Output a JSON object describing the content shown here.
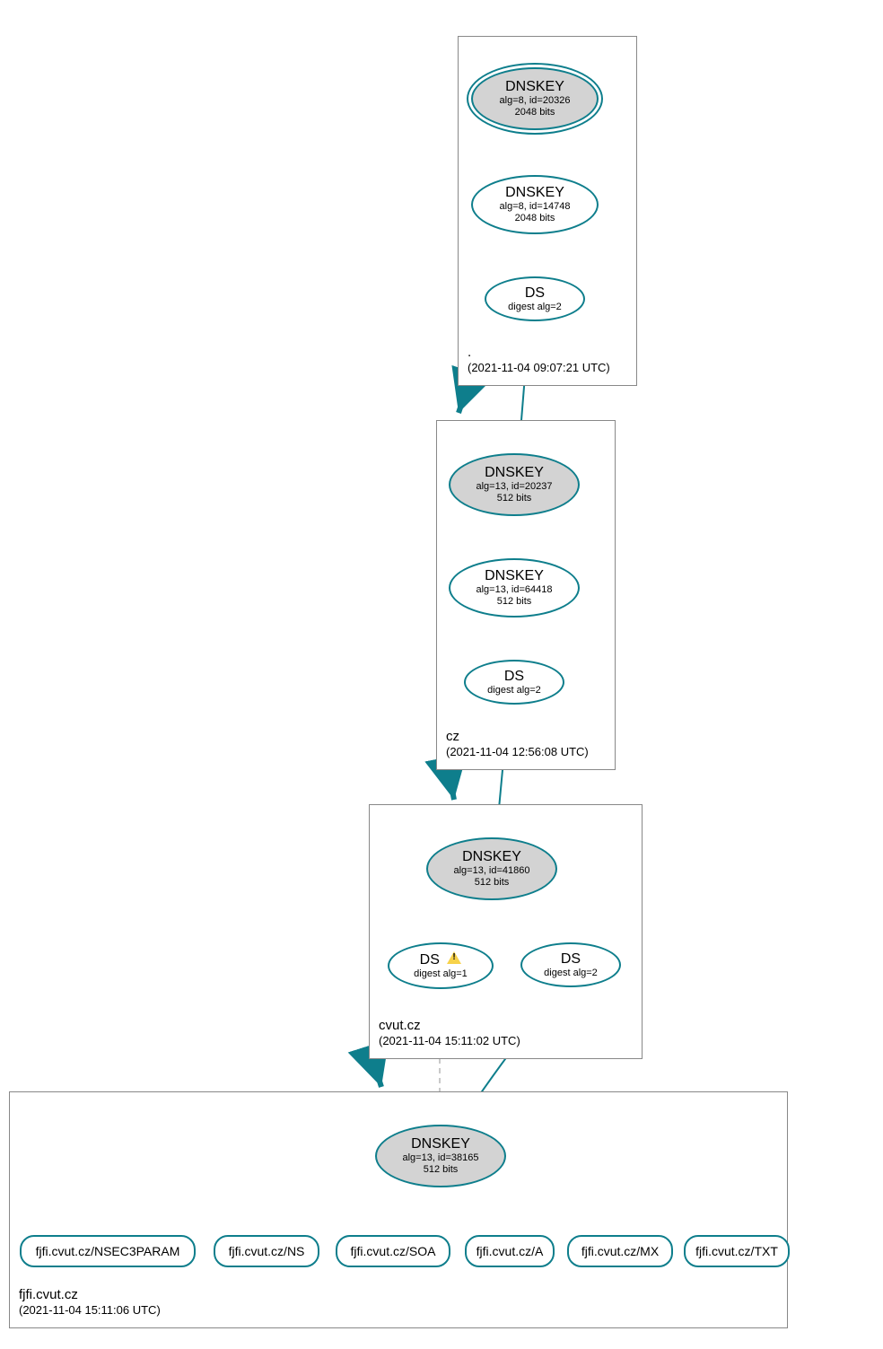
{
  "zones": {
    "root": {
      "name": ".",
      "timestamp": "(2021-11-04 09:07:21 UTC)"
    },
    "cz": {
      "name": "cz",
      "timestamp": "(2021-11-04 12:56:08 UTC)"
    },
    "cvut": {
      "name": "cvut.cz",
      "timestamp": "(2021-11-04 15:11:02 UTC)"
    },
    "fjfi": {
      "name": "fjfi.cvut.cz",
      "timestamp": "(2021-11-04 15:11:06 UTC)"
    }
  },
  "nodes": {
    "root_ksk": {
      "title": "DNSKEY",
      "line1": "alg=8, id=20326",
      "line2": "2048 bits"
    },
    "root_zsk": {
      "title": "DNSKEY",
      "line1": "alg=8, id=14748",
      "line2": "2048 bits"
    },
    "root_ds": {
      "title": "DS",
      "line1": "digest alg=2"
    },
    "cz_ksk": {
      "title": "DNSKEY",
      "line1": "alg=13, id=20237",
      "line2": "512 bits"
    },
    "cz_zsk": {
      "title": "DNSKEY",
      "line1": "alg=13, id=64418",
      "line2": "512 bits"
    },
    "cz_ds": {
      "title": "DS",
      "line1": "digest alg=2"
    },
    "cvut_ksk": {
      "title": "DNSKEY",
      "line1": "alg=13, id=41860",
      "line2": "512 bits"
    },
    "cvut_ds1": {
      "title": "DS",
      "line1": "digest alg=1"
    },
    "cvut_ds2": {
      "title": "DS",
      "line1": "digest alg=2"
    },
    "fjfi_ksk": {
      "title": "DNSKEY",
      "line1": "alg=13, id=38165",
      "line2": "512 bits"
    },
    "rr_nsec3p": {
      "label": "fjfi.cvut.cz/NSEC3PARAM"
    },
    "rr_ns": {
      "label": "fjfi.cvut.cz/NS"
    },
    "rr_soa": {
      "label": "fjfi.cvut.cz/SOA"
    },
    "rr_a": {
      "label": "fjfi.cvut.cz/A"
    },
    "rr_mx": {
      "label": "fjfi.cvut.cz/MX"
    },
    "rr_txt": {
      "label": "fjfi.cvut.cz/TXT"
    }
  }
}
